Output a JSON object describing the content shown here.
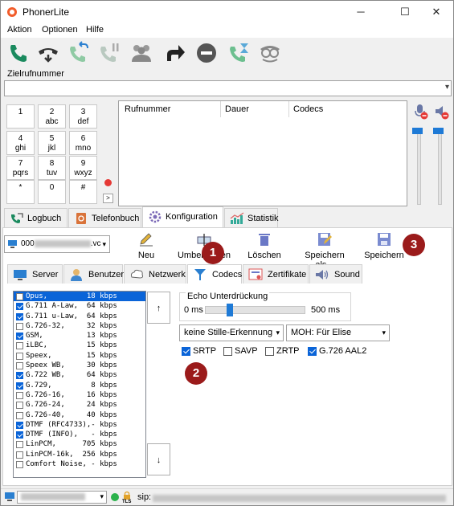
{
  "window": {
    "title": "PhonerLite",
    "controls": [
      "─",
      "☐",
      "✕"
    ]
  },
  "menu": [
    "Aktion",
    "Optionen",
    "Hilfe"
  ],
  "toolbar": [
    {
      "icon": "call-icon",
      "color": "#1a8a5e"
    },
    {
      "icon": "hang-up-down-icon",
      "color": "#333"
    },
    {
      "icon": "call-transfer-icon",
      "color": "#1a8a5e"
    },
    {
      "icon": "call-hold-icon",
      "color": "#9aa"
    },
    {
      "icon": "conference-icon",
      "color": "#777"
    },
    {
      "icon": "forward-arrow-icon",
      "color": "#222"
    },
    {
      "icon": "do-not-disturb-icon",
      "color": "#555"
    },
    {
      "icon": "call-wait-icon",
      "color": "#3a9"
    },
    {
      "icon": "anonymous-icon",
      "color": "#777"
    }
  ],
  "dial": {
    "label": "Zielrufnummer",
    "value": ""
  },
  "keypad": [
    {
      "d": "1",
      "l": ""
    },
    {
      "d": "2",
      "l": "abc"
    },
    {
      "d": "3",
      "l": "def"
    },
    {
      "d": "4",
      "l": "ghi"
    },
    {
      "d": "5",
      "l": "jkl"
    },
    {
      "d": "6",
      "l": "mno"
    },
    {
      "d": "7",
      "l": "pqrs"
    },
    {
      "d": "8",
      "l": "tuv"
    },
    {
      "d": "9",
      "l": "wxyz"
    },
    {
      "d": "*",
      "l": ""
    },
    {
      "d": "0",
      "l": ""
    },
    {
      "d": "#",
      "l": ""
    }
  ],
  "keypad_more": ">",
  "calllist": {
    "headers": [
      "Rufnummer",
      "Dauer",
      "Codecs"
    ]
  },
  "main_tabs": [
    {
      "label": "Logbuch",
      "icon": "logbook-icon",
      "active": false
    },
    {
      "label": "Telefonbuch",
      "icon": "phonebook-icon",
      "active": false
    },
    {
      "label": "Konfiguration",
      "icon": "config-gear-icon",
      "active": true
    },
    {
      "label": "Statistik",
      "icon": "statistics-icon",
      "active": false
    }
  ],
  "account": {
    "value_prefix": "000",
    "value_suffix": ".vc"
  },
  "account_buttons": [
    "Neu",
    "Umbenennen",
    "Löschen",
    "Speichern als...",
    "Speichern"
  ],
  "badges": [
    "1",
    "2",
    "3"
  ],
  "config_tabs": [
    {
      "label": "Server",
      "icon": "server-icon"
    },
    {
      "label": "Benutzer",
      "icon": "user-icon"
    },
    {
      "label": "Netzwerk",
      "icon": "network-icon"
    },
    {
      "label": "Codecs",
      "icon": "codecs-icon",
      "active": true
    },
    {
      "label": "Zertifikate",
      "icon": "certificate-icon"
    },
    {
      "label": "Sound",
      "icon": "sound-icon"
    }
  ],
  "codecs": [
    {
      "text": "Opus,         18 kbps",
      "checked": false,
      "selected": true
    },
    {
      "text": "G.711 A-Law,  64 kbps",
      "checked": true
    },
    {
      "text": "G.711 u-Law,  64 kbps",
      "checked": true
    },
    {
      "text": "G.726-32,     32 kbps",
      "checked": false
    },
    {
      "text": "GSM,          13 kbps",
      "checked": true
    },
    {
      "text": "iLBC,         15 kbps",
      "checked": false
    },
    {
      "text": "Speex,        15 kbps",
      "checked": false
    },
    {
      "text": "Speex WB,     30 kbps",
      "checked": false
    },
    {
      "text": "G.722 WB,     64 kbps",
      "checked": true
    },
    {
      "text": "G.729,         8 kbps",
      "checked": true
    },
    {
      "text": "G.726-16,     16 kbps",
      "checked": false
    },
    {
      "text": "G.726-24,     24 kbps",
      "checked": false
    },
    {
      "text": "G.726-40,     40 kbps",
      "checked": false
    },
    {
      "text": "DTMF (RFC4733),- kbps",
      "checked": true
    },
    {
      "text": "DTMF (INFO),   - kbps",
      "checked": true
    },
    {
      "text": "LinPCM,      705 kbps",
      "checked": false
    },
    {
      "text": "LinPCM-16k,  256 kbps",
      "checked": false
    },
    {
      "text": "Comfort Noise, - kbps",
      "checked": false
    }
  ],
  "move_buttons": [
    "↑",
    "↓"
  ],
  "echo": {
    "label": "Echo Unterdrückung",
    "min": "0 ms",
    "max": "500 ms",
    "level": 0.25
  },
  "silence_select": "keine Stille-Erkennung",
  "moh_select": "MOH: Für Elise",
  "checkboxes": [
    {
      "label": "SRTP",
      "checked": true
    },
    {
      "label": "SAVP",
      "checked": false
    },
    {
      "label": "ZRTP",
      "checked": false
    },
    {
      "label": "G.726 AAL2",
      "checked": true
    }
  ],
  "status": {
    "sip_prefix": "sip:",
    "tls": "TLS"
  }
}
